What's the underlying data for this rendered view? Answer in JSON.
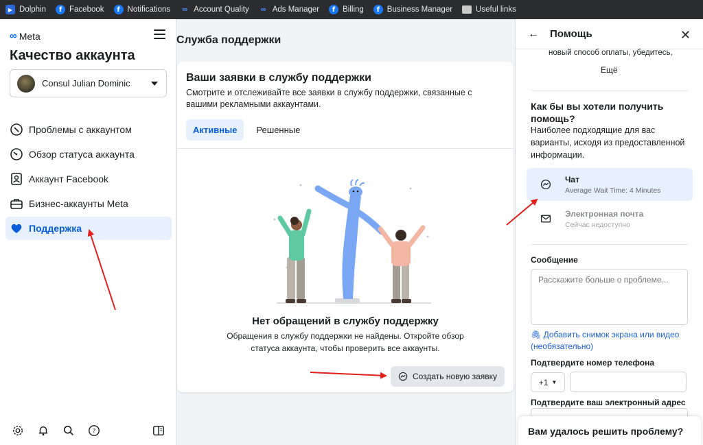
{
  "bookmarks": [
    {
      "label": "Dolphin",
      "icon": "dolphin-icon"
    },
    {
      "label": "Facebook",
      "icon": "facebook-icon"
    },
    {
      "label": "Notifications",
      "icon": "facebook-icon"
    },
    {
      "label": "Account Quality",
      "icon": "meta-icon"
    },
    {
      "label": "Ads Manager",
      "icon": "meta-icon"
    },
    {
      "label": "Billing",
      "icon": "facebook-icon"
    },
    {
      "label": "Business Manager",
      "icon": "facebook-icon"
    },
    {
      "label": "Useful links",
      "icon": "folder-icon"
    }
  ],
  "sidebar": {
    "logo": "Meta",
    "title": "Качество аккаунта",
    "account_name": "Consul Julian Dominic",
    "items": [
      {
        "label": "Проблемы с аккаунтом",
        "icon": "alert-circle-icon",
        "active": false
      },
      {
        "label": "Обзор статуса аккаунта",
        "icon": "gauge-icon",
        "active": false
      },
      {
        "label": "Аккаунт Facebook",
        "icon": "profile-card-icon",
        "active": false
      },
      {
        "label": "Бизнес-аккаунты Meta",
        "icon": "briefcase-icon",
        "active": false
      },
      {
        "label": "Поддержка",
        "icon": "heart-icon",
        "active": true
      }
    ],
    "bottom_icons": [
      "gear-icon",
      "bell-icon",
      "search-icon",
      "help-icon",
      "panel-toggle-icon"
    ]
  },
  "main": {
    "title": "Служба поддержки",
    "card": {
      "title": "Ваши заявки в службу поддержки",
      "subtitle": "Смотрите и отслеживайте все заявки в службу поддержки, связанные с вашими рекламными аккаунтами.",
      "tabs": [
        {
          "label": "Активные",
          "active": true
        },
        {
          "label": "Решенные",
          "active": false
        }
      ],
      "empty_title": "Нет обращений в службу поддержку",
      "empty_sub": "Обращения в службу поддержки не найдены. Откройте обзор статуса аккаунта, чтобы проверить все аккаунты.",
      "new_button": "Создать новую заявку"
    }
  },
  "panel": {
    "title": "Помощь",
    "snippet": "новый способ оплаты, убедитесь,",
    "more": "Ещё",
    "question": "Как бы вы хотели получить помощь?",
    "question_sub": "Наиболее подходящие для вас варианты, исходя из предоставленной информации.",
    "options": [
      {
        "title": "Чат",
        "subtitle": "Average Wait Time: 4 Minutes",
        "selected": true,
        "icon": "messenger-icon"
      },
      {
        "title": "Электронная почта",
        "subtitle": "Сейчас недоступно",
        "selected": false,
        "icon": "envelope-icon"
      }
    ],
    "message_label": "Сообщение",
    "message_placeholder": "Расскажите больше о проблеме...",
    "screenshot_link": "Добавить снимок экрана или видео (необязательно)",
    "phone_label": "Подтвердите номер телефона",
    "phone_code": "+1",
    "email_label": "Подтвердите ваш электронный адрес",
    "resolved": "Вам удалось решить проблему?"
  },
  "colors": {
    "accent": "#0a5fd8",
    "accent_bg": "#e7f0fd",
    "arrow": "#e0201b"
  }
}
